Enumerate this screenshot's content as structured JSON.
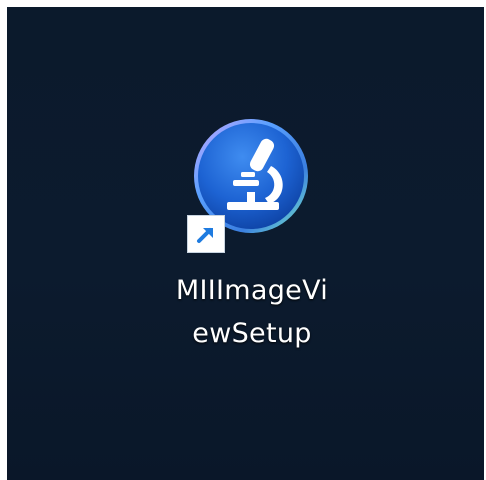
{
  "desktop": {
    "background_color": "#0c1b2e",
    "shortcut": {
      "icon": "microscope-icon",
      "overlay_icon": "shortcut-arrow-icon",
      "label_line1": "MIIImageVi",
      "label_line2": "ewSetup",
      "accent_color": "#1d6ad8"
    }
  }
}
